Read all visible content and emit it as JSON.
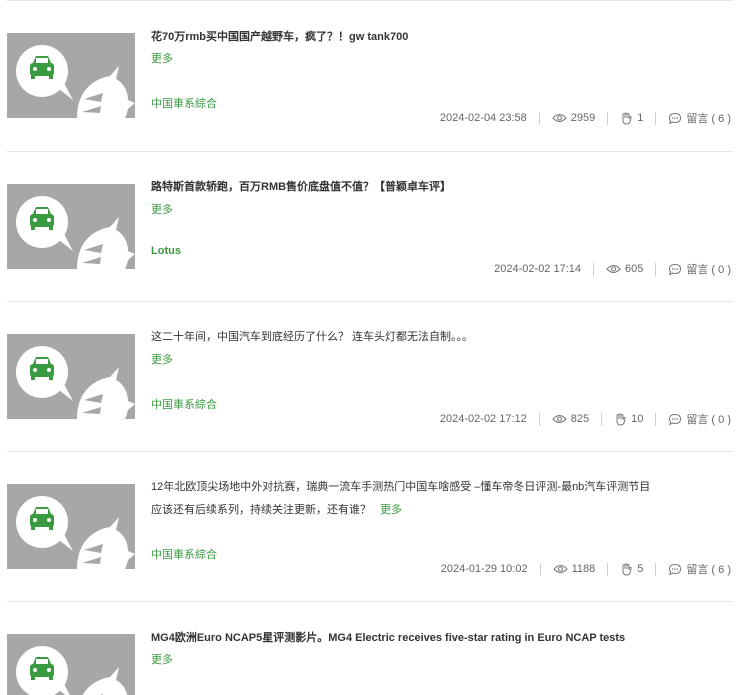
{
  "posts": [
    {
      "title": "花70万rmb买中国国产越野车，疯了？！gw tank700",
      "excerpt": "",
      "more_label": "更多",
      "category": "中国車系綜合",
      "date": "2024-02-04 23:58",
      "views": "2959",
      "likes": "1",
      "comments_label": "留言 ( 6 )"
    },
    {
      "title": "路特斯首款轿跑，百万RMB售价底盘值不值？【普颖卓车评】",
      "excerpt": "",
      "more_label": "更多",
      "category": "Lotus",
      "date": "2024-02-02 17:14",
      "views": "605",
      "likes": "",
      "comments_label": "留言 ( 0 )"
    },
    {
      "title": "这二十年间，中国汽车到底经历了什么？ 连车头灯都无法自制。。。",
      "excerpt": "",
      "more_label": "更多",
      "category": "中国車系綜合",
      "date": "2024-02-02 17:12",
      "views": "825",
      "likes": "10",
      "comments_label": "留言 ( 0 )"
    },
    {
      "title": "12年北欧顶尖场地中外对抗赛，瑞典一流车手测热门中国车啥感受 –懂车帝冬日评测-最nb汽车评测节目",
      "excerpt": "应该还有后续系列，持续关注更新，还有谁？",
      "more_label": "更多",
      "category": "中国車系綜合",
      "date": "2024-01-29 10:02",
      "views": "1188",
      "likes": "5",
      "comments_label": "留言 ( 6 )"
    },
    {
      "title": "MG4欧洲Euro NCAP5星评测影片。MG4 Electric receives five-star rating in Euro NCAP tests",
      "excerpt": "",
      "more_label": "更多",
      "category": "",
      "date": "",
      "views": "",
      "likes": "",
      "comments_label": ""
    }
  ],
  "colors": {
    "accent": "#3a9a40",
    "thumb_bg": "#a7a7a7",
    "text": "#333333",
    "meta": "#666666"
  },
  "icons": {
    "thumbnail": "car-speech-bubble-placeholder-icon",
    "views": "eye-icon",
    "likes": "clap-hand-icon",
    "comments": "speech-bubble-dots-icon"
  }
}
